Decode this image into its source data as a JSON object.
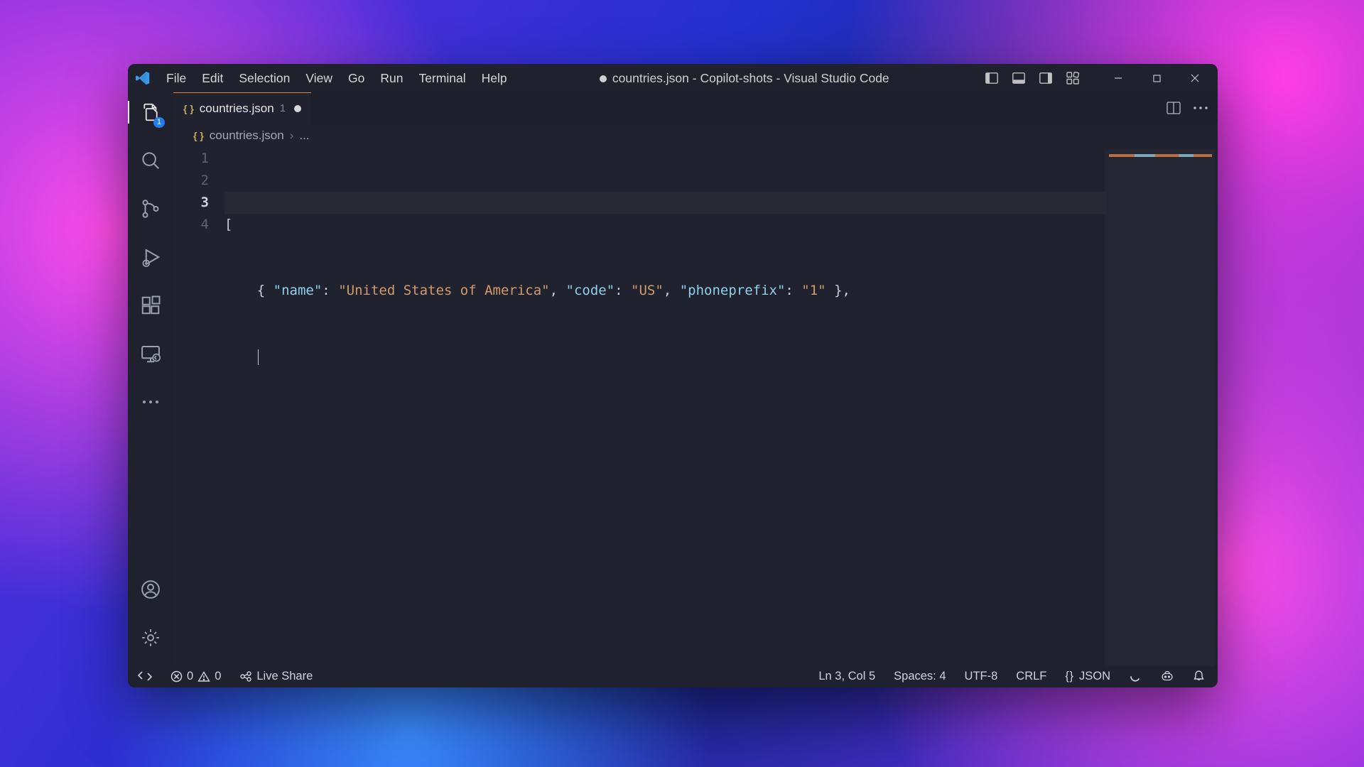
{
  "menu": {
    "file": "File",
    "edit": "Edit",
    "selection": "Selection",
    "view": "View",
    "go": "Go",
    "run": "Run",
    "terminal": "Terminal",
    "help": "Help"
  },
  "title": "countries.json - Copilot-shots - Visual Studio Code",
  "activity": {
    "explorer_badge": "1"
  },
  "tab": {
    "name": "countries.json",
    "num": "1"
  },
  "breadcrumb": {
    "file": "countries.json",
    "more": "..."
  },
  "code": {
    "l1": "[",
    "l2_indent": "    ",
    "l2_open": "{ ",
    "l2_k_name": "\"name\"",
    "l2_c1": ": ",
    "l2_v_name": "\"United States of America\"",
    "l2_s1": ", ",
    "l2_k_code": "\"code\"",
    "l2_c2": ": ",
    "l2_v_code": "\"US\"",
    "l2_s2": ", ",
    "l2_k_pp": "\"phoneprefix\"",
    "l2_c3": ": ",
    "l2_v_pp": "\"1\"",
    "l2_close": " },"
  },
  "lines": {
    "n1": "1",
    "n2": "2",
    "n3": "3",
    "n4": "4"
  },
  "status": {
    "errors": "0",
    "warnings": "0",
    "liveshare": "Live Share",
    "pos": "Ln 3, Col 5",
    "spaces": "Spaces: 4",
    "enc": "UTF-8",
    "eol": "CRLF",
    "lang": "JSON",
    "lang_icon": "{ }"
  }
}
